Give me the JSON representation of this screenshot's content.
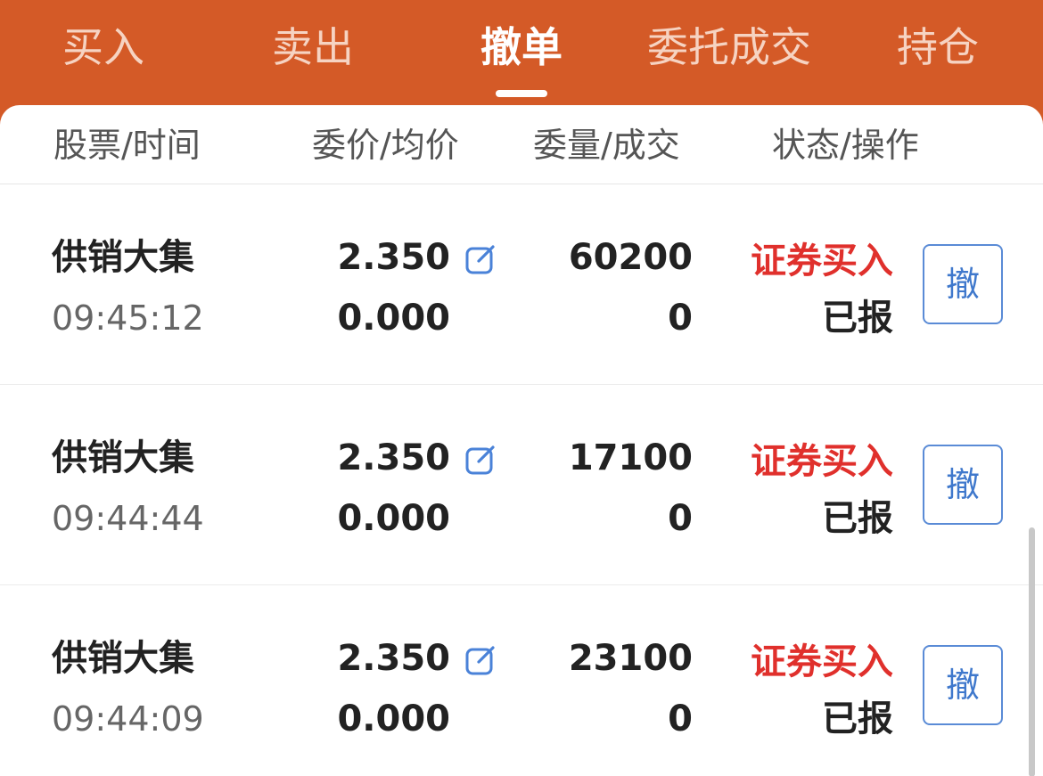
{
  "tabs": [
    {
      "label": "买入"
    },
    {
      "label": "卖出"
    },
    {
      "label": "撤单"
    },
    {
      "label": "委托成交"
    },
    {
      "label": "持仓"
    }
  ],
  "active_tab": "撤单",
  "columns": [
    "股票/时间",
    "委价/均价",
    "委量/成交",
    "状态/操作"
  ],
  "orders": [
    {
      "name": "供销大集",
      "time": "09:45:12",
      "price": "2.350",
      "avg_price": "0.000",
      "qty": "60200",
      "filled": "0",
      "side": "证券买入",
      "status": "已报",
      "action": "撤"
    },
    {
      "name": "供销大集",
      "time": "09:44:44",
      "price": "2.350",
      "avg_price": "0.000",
      "qty": "17100",
      "filled": "0",
      "side": "证券买入",
      "status": "已报",
      "action": "撤"
    },
    {
      "name": "供销大集",
      "time": "09:44:09",
      "price": "2.350",
      "avg_price": "0.000",
      "qty": "23100",
      "filled": "0",
      "side": "证券买入",
      "status": "已报",
      "action": "撤"
    }
  ],
  "icons": {
    "edit": "edit-icon"
  },
  "colors": {
    "brand": "#d45a27",
    "sell_buy_text": "#e0302c",
    "accent_blue": "#3f78cc"
  }
}
